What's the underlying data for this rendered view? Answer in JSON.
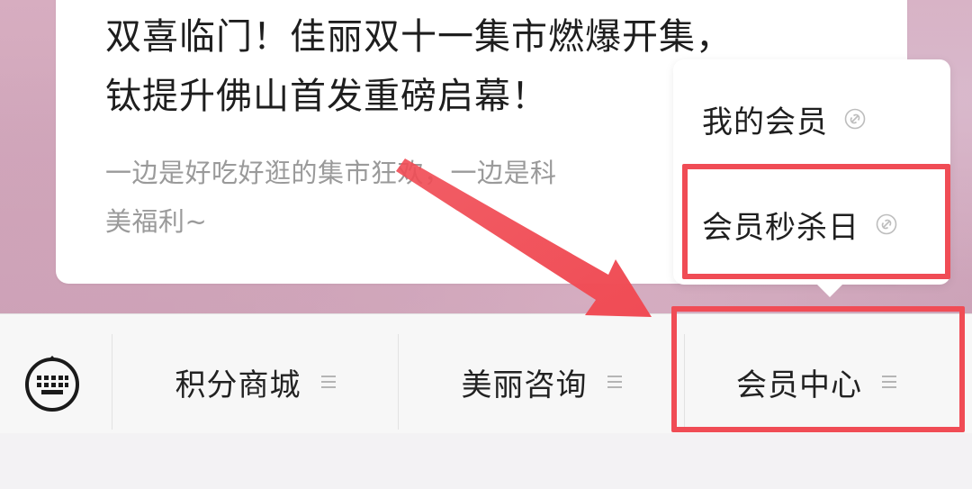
{
  "article": {
    "title_line1": "双喜临门！佳丽双十一集市燃爆开集，",
    "title_line2": "钛提升佛山首发重磅启幕！",
    "desc_line1": "一边是好吃好逛的集市狂欢，一边是科",
    "desc_line2": "美福利~"
  },
  "bottom_menu": {
    "keyboard_icon": "keyboard-icon",
    "items": [
      {
        "label": "积分商城",
        "icon": "menu-lines-icon"
      },
      {
        "label": "美丽咨询",
        "icon": "menu-lines-icon"
      },
      {
        "label": "会员中心",
        "icon": "menu-lines-icon"
      }
    ]
  },
  "submenu": {
    "items": [
      {
        "label": "我的会员",
        "icon": "mini-program-link-icon"
      },
      {
        "label": "会员秒杀日",
        "icon": "mini-program-link-icon"
      }
    ]
  },
  "annotations": {
    "highlight_color": "#f04c55",
    "arrow_color": "#f04c55"
  }
}
